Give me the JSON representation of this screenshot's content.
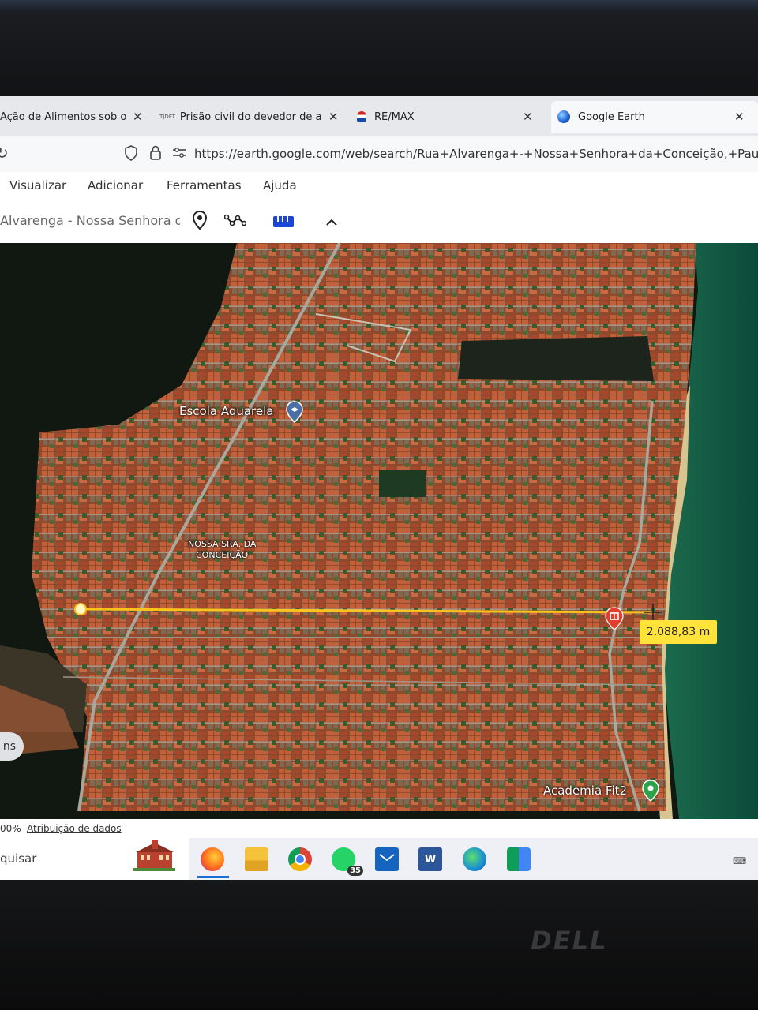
{
  "browser": {
    "tabs": [
      {
        "label": "Ação de Alimentos sob o reg",
        "favicon": "doc-icon"
      },
      {
        "label": "Prisão civil do devedor de alim",
        "favicon": "tjdft-icon",
        "favicon_text": "TJDFT"
      },
      {
        "label": "RE/MAX",
        "favicon": "remax-balloon-icon"
      },
      {
        "label": "Google Earth",
        "favicon": "earth-icon",
        "active": true
      }
    ],
    "url": "https://earth.google.com/web/search/Rua+Alvarenga+-+Nossa+Senhora+da+Conceição,+Paulista+-+"
  },
  "earth": {
    "menu": [
      "Visualizar",
      "Adicionar",
      "Ferramentas",
      "Ajuda"
    ],
    "search_value": "Alvarenga - Nossa Senhora da",
    "map_labels": {
      "school": "Escola Aquarela",
      "neighborhood_line1": "NOSSA SRA. DA",
      "neighborhood_line2": "CONCEIÇÃO",
      "gym": "Academia Fit2"
    },
    "measurement": "2.088,83 m",
    "left_button_fragment": "ns",
    "status": {
      "zoom_fragment": "00%",
      "attribution": "Atribuição de dados"
    }
  },
  "taskbar": {
    "search_fragment": "quisar",
    "whatsapp_badge": "35",
    "apps": [
      "firefox-icon",
      "file-explorer-icon",
      "chrome-icon",
      "whatsapp-icon",
      "mail-icon",
      "word-icon",
      "edge-icon",
      "meet-icon"
    ]
  },
  "colors": {
    "measure_line": "#ffc21c",
    "measure_label_bg": "#ffe23a",
    "sea": "#0f5a44",
    "roofs": "#b3552f"
  }
}
